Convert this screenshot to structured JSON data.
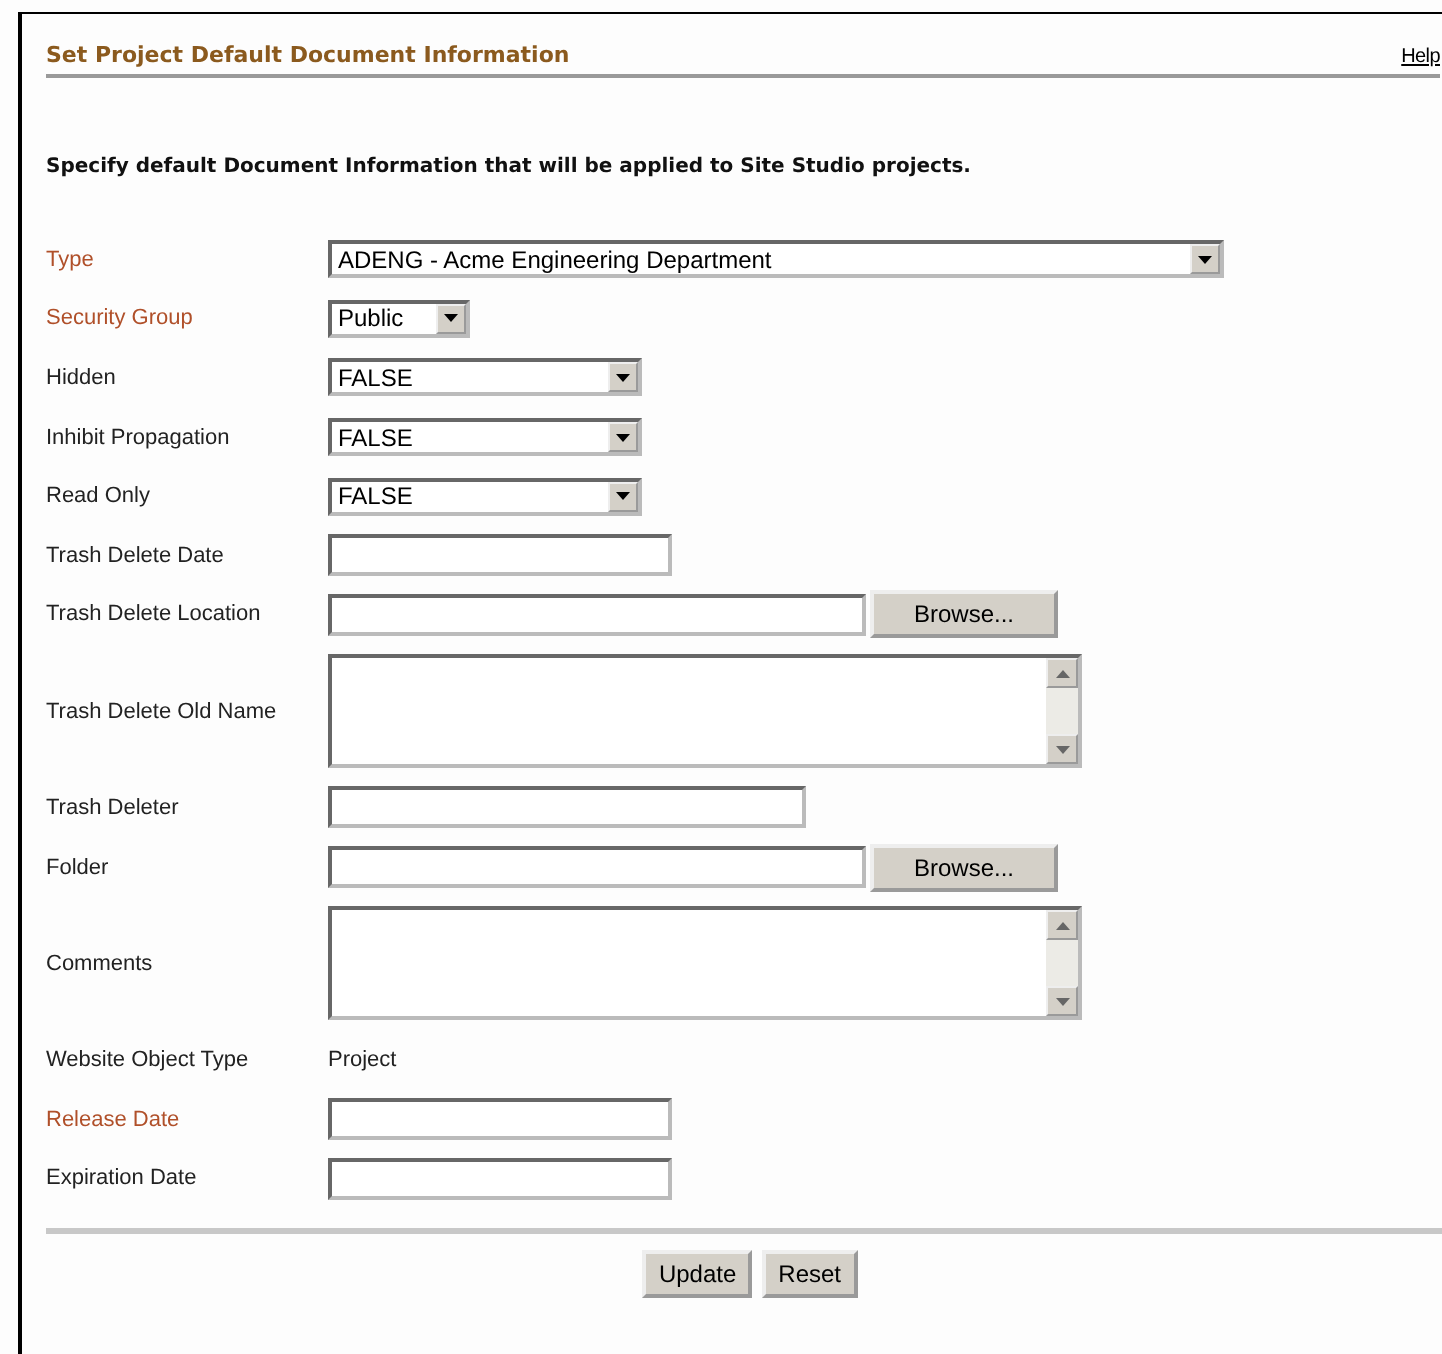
{
  "header": {
    "title": "Set Project Default Document Information",
    "help_link": "Help"
  },
  "description": "Specify default Document Information that will be applied to Site Studio projects.",
  "fields": [
    {
      "label": "Type",
      "required": true,
      "kind": "select",
      "value": "ADENG - Acme Engineering Department"
    },
    {
      "label": "Security Group",
      "required": true,
      "kind": "select",
      "value": "Public"
    },
    {
      "label": "Hidden",
      "required": false,
      "kind": "select",
      "value": "FALSE"
    },
    {
      "label": "Inhibit Propagation",
      "required": false,
      "kind": "select",
      "value": "FALSE"
    },
    {
      "label": "Read Only",
      "required": false,
      "kind": "select",
      "value": "FALSE"
    },
    {
      "label": "Trash Delete Date",
      "required": false,
      "kind": "text"
    },
    {
      "label": "Trash Delete Location",
      "required": false,
      "kind": "browse",
      "button": "Browse..."
    },
    {
      "label": "Trash Delete Old Name",
      "required": false,
      "kind": "textarea"
    },
    {
      "label": "Trash Deleter",
      "required": false,
      "kind": "text"
    },
    {
      "label": "Folder",
      "required": false,
      "kind": "browse",
      "button": "Browse..."
    },
    {
      "label": "Comments",
      "required": false,
      "kind": "textarea"
    },
    {
      "label": "Website Object Type",
      "required": false,
      "kind": "static",
      "value": "Project"
    },
    {
      "label": "Release Date",
      "required": true,
      "kind": "text"
    },
    {
      "label": "Expiration Date",
      "required": false,
      "kind": "text"
    }
  ],
  "buttons": [
    "Update",
    "Reset"
  ]
}
